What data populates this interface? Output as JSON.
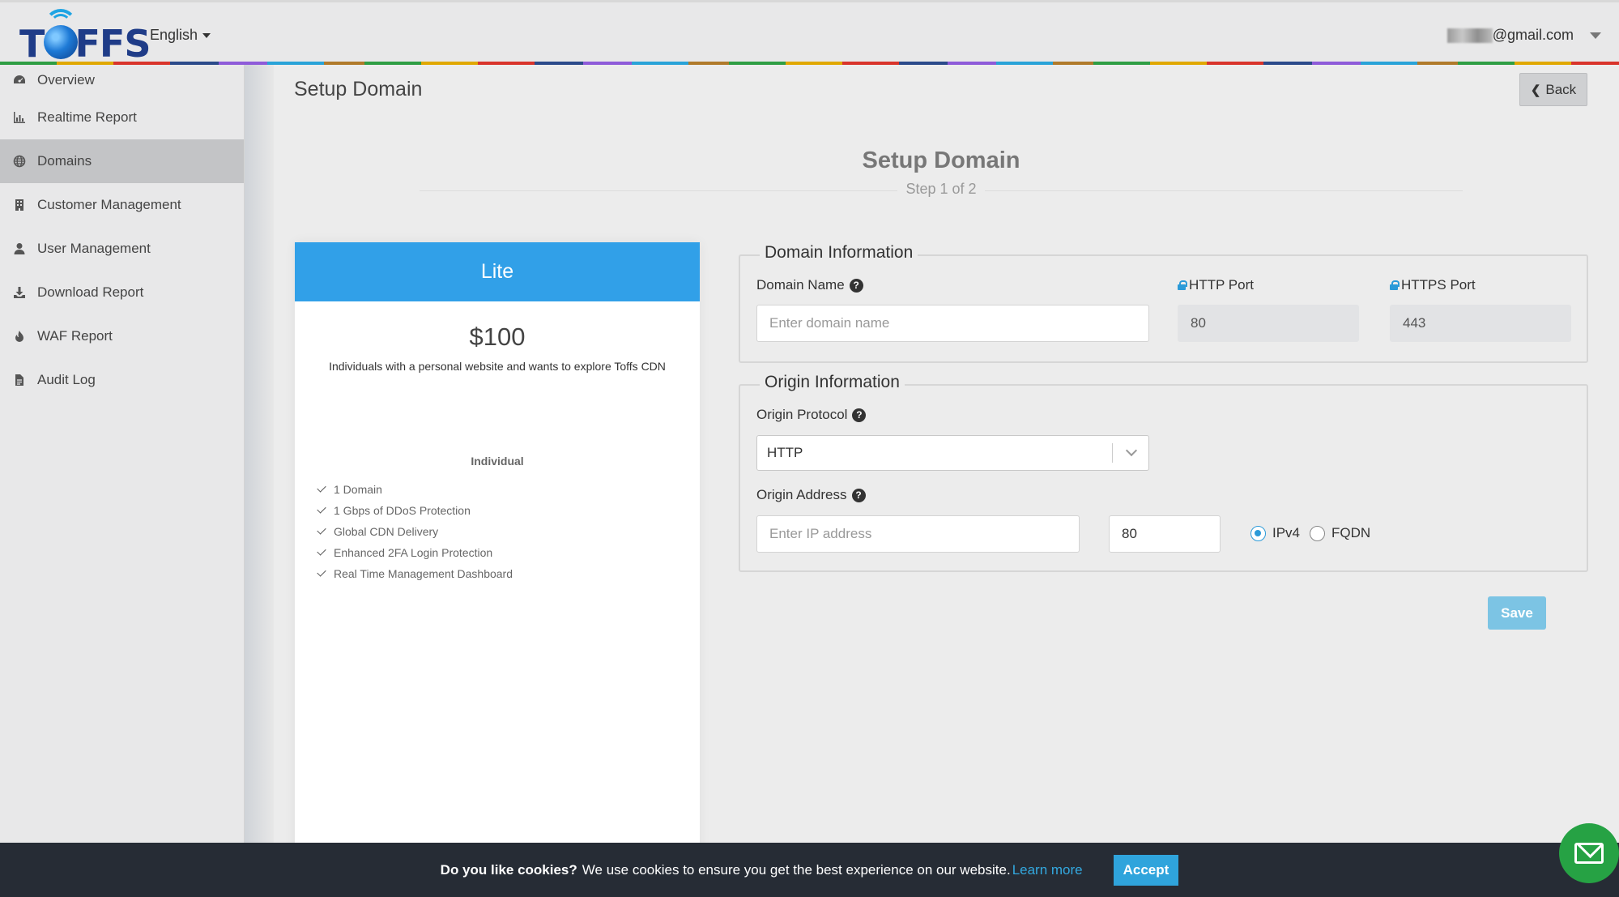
{
  "header": {
    "logo_text": "TOFFS",
    "language": "English",
    "user_email": "@gmail.com"
  },
  "sidebar": {
    "items": [
      {
        "label": "Overview",
        "icon": "dashboard-icon"
      },
      {
        "label": "Realtime Report",
        "icon": "bar-chart-icon"
      },
      {
        "label": "Domains",
        "icon": "globe-icon",
        "active": true
      },
      {
        "label": "Customer Management",
        "icon": "building-icon"
      },
      {
        "label": "User Management",
        "icon": "user-icon"
      },
      {
        "label": "Download Report",
        "icon": "download-icon"
      },
      {
        "label": "WAF Report",
        "icon": "fire-icon"
      },
      {
        "label": "Audit Log",
        "icon": "file-icon"
      }
    ]
  },
  "page": {
    "title": "Setup Domain",
    "back_label": "Back",
    "center_title": "Setup Domain",
    "step_text": "Step 1 of 2"
  },
  "plan": {
    "name": "Lite",
    "price": "$100",
    "description": "Individuals with a personal website and wants to explore Toffs CDN",
    "tier": "Individual",
    "features": [
      "1 Domain",
      "1 Gbps of DDoS Protection",
      "Global CDN Delivery",
      "Enhanced 2FA Login Protection",
      "Real Time Management Dashboard"
    ],
    "header_color": "#31a0e8"
  },
  "domain_info": {
    "legend": "Domain Information",
    "domain_name_label": "Domain Name",
    "domain_name_placeholder": "Enter domain name",
    "http_port_label": "HTTP Port",
    "http_port_value": "80",
    "https_port_label": "HTTPS Port",
    "https_port_value": "443"
  },
  "origin_info": {
    "legend": "Origin Information",
    "protocol_label": "Origin Protocol",
    "protocol_value": "HTTP",
    "address_label": "Origin Address",
    "address_placeholder": "Enter IP address",
    "port_value": "80",
    "radio_ipv4": "IPv4",
    "radio_fqdn": "FQDN",
    "selected": "IPv4"
  },
  "save_label": "Save",
  "cookie": {
    "question": "Do you like cookies?",
    "message": "We use cookies to ensure you get the best experience on our website.",
    "learn_more": "Learn more",
    "accept": "Accept"
  },
  "colors": {
    "accent": "#2b9ad8",
    "cookie_bg": "#262c35",
    "chat_button": "#26a244"
  }
}
